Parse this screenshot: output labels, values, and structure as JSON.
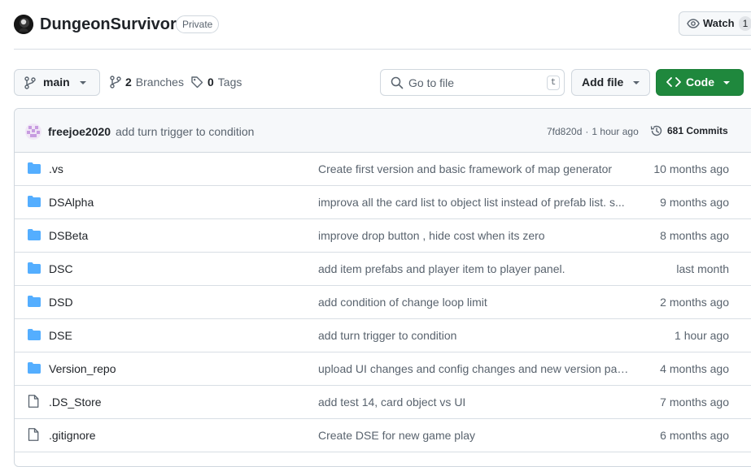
{
  "repo": {
    "name": "DungeonSurvivor",
    "visibility": "Private"
  },
  "watch": {
    "label": "Watch",
    "count": "1"
  },
  "toolbar": {
    "branch": "main",
    "branches_count": "2",
    "branches_label": "Branches",
    "tags_count": "0",
    "tags_label": "Tags",
    "search_placeholder": "Go to file",
    "search_shortcut": "t",
    "add_file": "Add file",
    "code": "Code"
  },
  "commit": {
    "author": "freejoe2020",
    "message": "add turn trigger to condition",
    "hash": "7fd820d",
    "separator": "·",
    "time": "1 hour ago",
    "commits_label": "681 Commits"
  },
  "files": [
    {
      "type": "folder",
      "name": ".vs",
      "message": "Create first version and basic framework of map generator",
      "date": "10 months ago"
    },
    {
      "type": "folder",
      "name": "DSAlpha",
      "message": "improva all the card list to object list instead of prefab list. s...",
      "date": "9 months ago"
    },
    {
      "type": "folder",
      "name": "DSBeta",
      "message": "improve drop button , hide cost when its zero",
      "date": "8 months ago"
    },
    {
      "type": "folder",
      "name": "DSC",
      "message": "add item prefabs and player item to player panel.",
      "date": "last month"
    },
    {
      "type": "folder",
      "name": "DSD",
      "message": "add condition of change loop limit",
      "date": "2 months ago"
    },
    {
      "type": "folder",
      "name": "DSE",
      "message": "add turn trigger to condition",
      "date": "1 hour ago"
    },
    {
      "type": "folder",
      "name": "Version_repo",
      "message": "upload UI changes and config changes and new version pac...",
      "date": "4 months ago"
    },
    {
      "type": "file",
      "name": ".DS_Store",
      "message": "add test 14, card object vs UI",
      "date": "7 months ago"
    },
    {
      "type": "file",
      "name": ".gitignore",
      "message": "Create DSE for new game play",
      "date": "6 months ago"
    }
  ],
  "colors": {
    "folder": "#54aeff",
    "primary_button": "#1f883d",
    "muted_text": "#59636e"
  }
}
